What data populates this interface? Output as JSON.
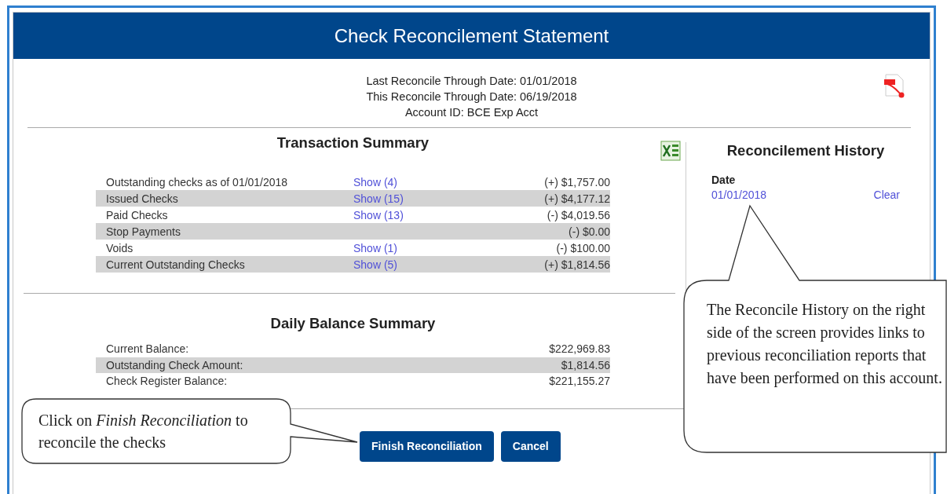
{
  "header": {
    "title": "Check Reconcilement Statement"
  },
  "info_lines": [
    "Last Reconcile Through Date: 01/01/2018",
    "This Reconcile Through Date: 06/19/2018",
    "Account ID: BCE Exp Acct"
  ],
  "transaction_summary": {
    "title": "Transaction Summary",
    "rows": [
      {
        "label": "Outstanding checks as of 01/01/2018",
        "link": "Show (4)",
        "amount": "(+) $1,757.00"
      },
      {
        "label": "Issued Checks",
        "link": "Show (15)",
        "amount": "(+) $4,177.12"
      },
      {
        "label": "Paid Checks",
        "link": "Show (13)",
        "amount": "(-) $4,019.56"
      },
      {
        "label": "Stop Payments",
        "amount": "(-) $0.00"
      },
      {
        "label": "Voids",
        "link": "Show (1)",
        "amount": "(-) $100.00"
      },
      {
        "label": "Current Outstanding Checks",
        "link": "Show (5)",
        "amount": "(+) $1,814.56"
      }
    ]
  },
  "daily_balance_summary": {
    "title": "Daily Balance Summary",
    "rows": [
      {
        "label": "Current Balance:",
        "amount": "$222,969.83"
      },
      {
        "label": "Outstanding Check Amount:",
        "amount": "$1,814.56"
      },
      {
        "label": "Check Register Balance:",
        "amount": "$221,155.27"
      }
    ]
  },
  "reconcilement_history": {
    "title": "Reconcilement History",
    "column": "Date",
    "rows": [
      {
        "date": "01/01/2018",
        "action": "Clear"
      }
    ]
  },
  "buttons": [
    {
      "label": "Finish Reconciliation"
    },
    {
      "label": "Cancel"
    }
  ],
  "callouts": [
    {
      "text": "Click on *Finish Reconciliation* to reconcile the checks"
    },
    {
      "text": "The Reconcile History on the right side of the screen provides links to previous reconciliation reports that have been performed on this account."
    }
  ]
}
